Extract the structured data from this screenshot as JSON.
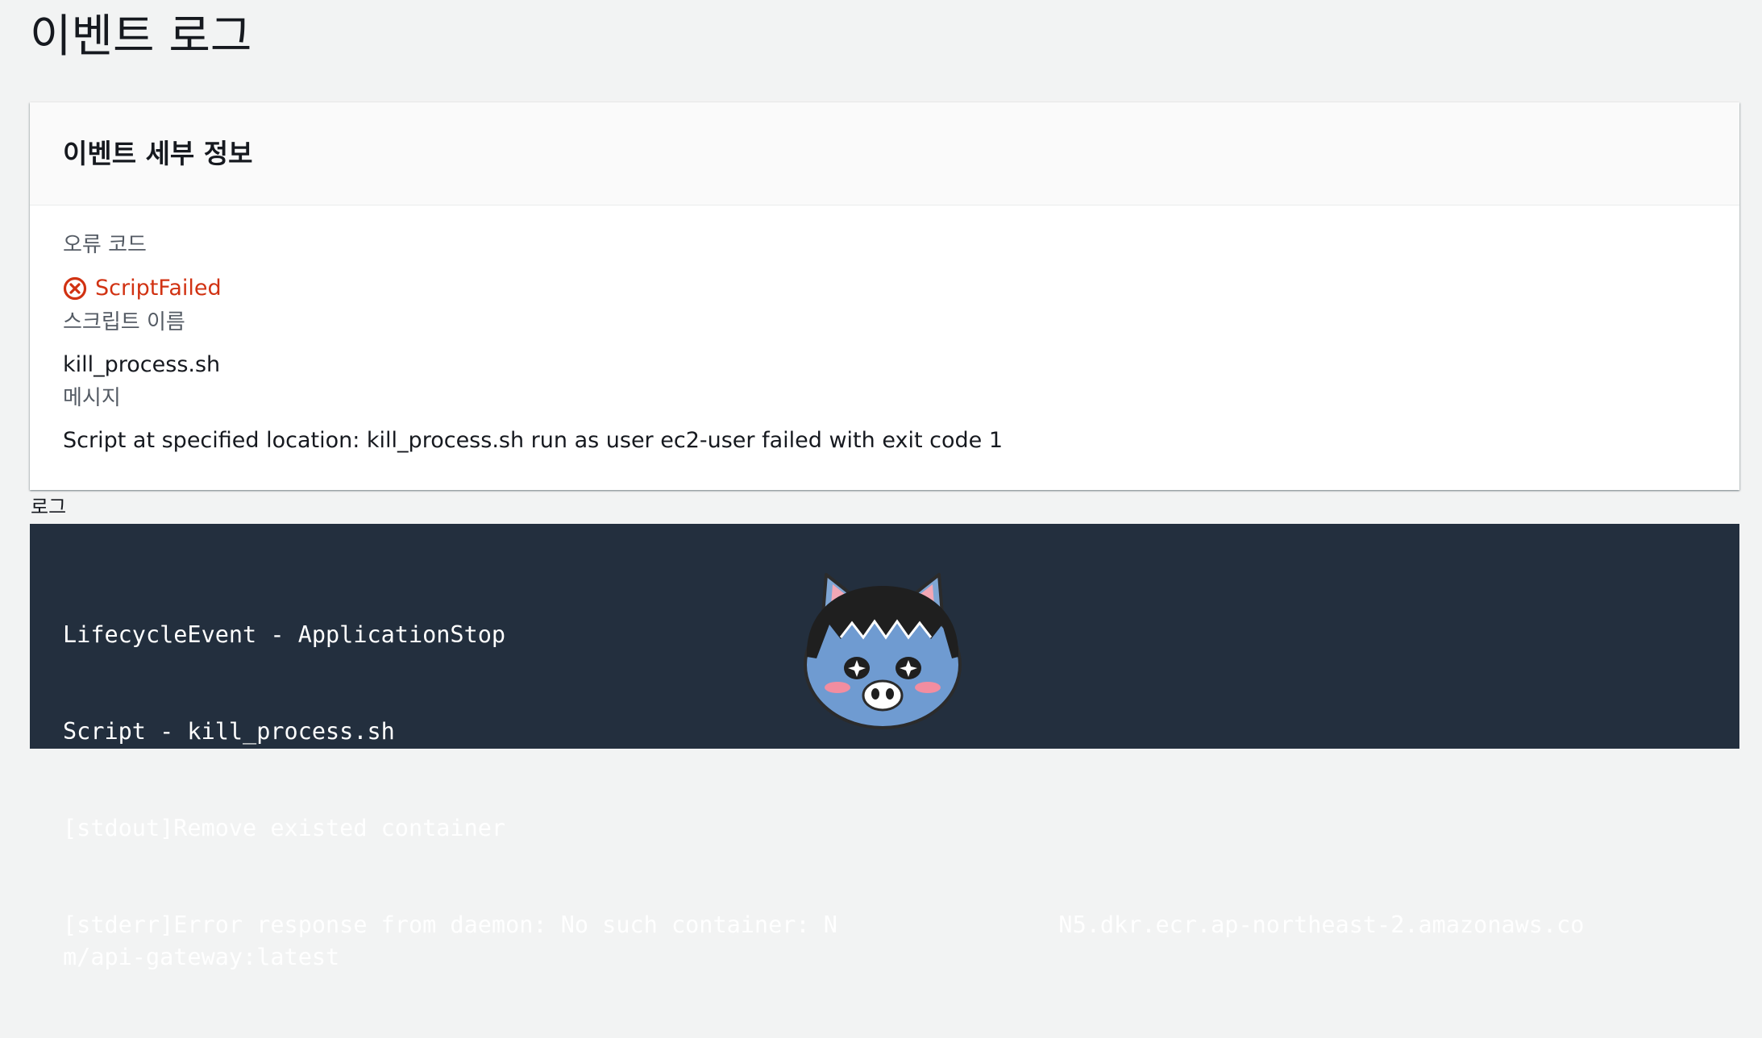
{
  "page": {
    "title": "이벤트 로그"
  },
  "details": {
    "title": "이벤트 세부 정보",
    "error_code_label": "오류 코드",
    "error_code_value": "ScriptFailed",
    "script_name_label": "스크립트 이름",
    "script_name_value": "kill_process.sh",
    "message_label": "메시지",
    "message_value": "Script at specified location: kill_process.sh run as user ec2-user failed with exit code 1"
  },
  "log": {
    "label": "로그",
    "lines": [
      "LifecycleEvent - ApplicationStop",
      "Script - kill_process.sh",
      "[stdout]Remove existed container",
      "[stderr]Error response from daemon: No such container: N                N5.dkr.ecr.ap-northeast-2.amazonaws.com/api-gateway:latest"
    ]
  },
  "icons": {
    "error_icon": "x-circle-icon",
    "sticker": "cat-character-sticker"
  },
  "colors": {
    "error": "#d13212",
    "log_background": "#232f3e",
    "page_background": "#f2f3f3"
  }
}
